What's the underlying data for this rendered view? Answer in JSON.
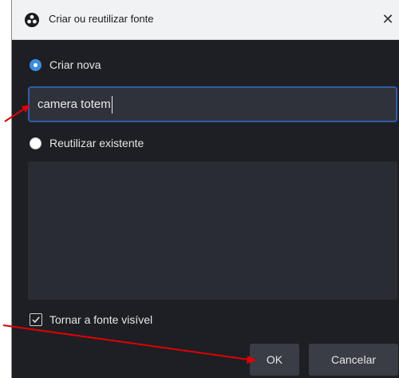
{
  "window": {
    "title": "Criar ou reutilizar fonte",
    "close_glyph": "✕"
  },
  "options": {
    "create_new": {
      "label": "Criar nova",
      "selected": true
    },
    "reuse_existing": {
      "label": "Reutilizar existente",
      "selected": false
    }
  },
  "name_input": {
    "value": "camera totem"
  },
  "existing_sources": [],
  "visible_checkbox": {
    "label": "Tornar a fonte visível",
    "checked": true
  },
  "buttons": {
    "ok": "OK",
    "cancel": "Cancelar"
  },
  "annotation": {
    "arrow_color": "#e00000"
  },
  "colors": {
    "accent": "#3c8dde",
    "background": "#1e1f25"
  }
}
